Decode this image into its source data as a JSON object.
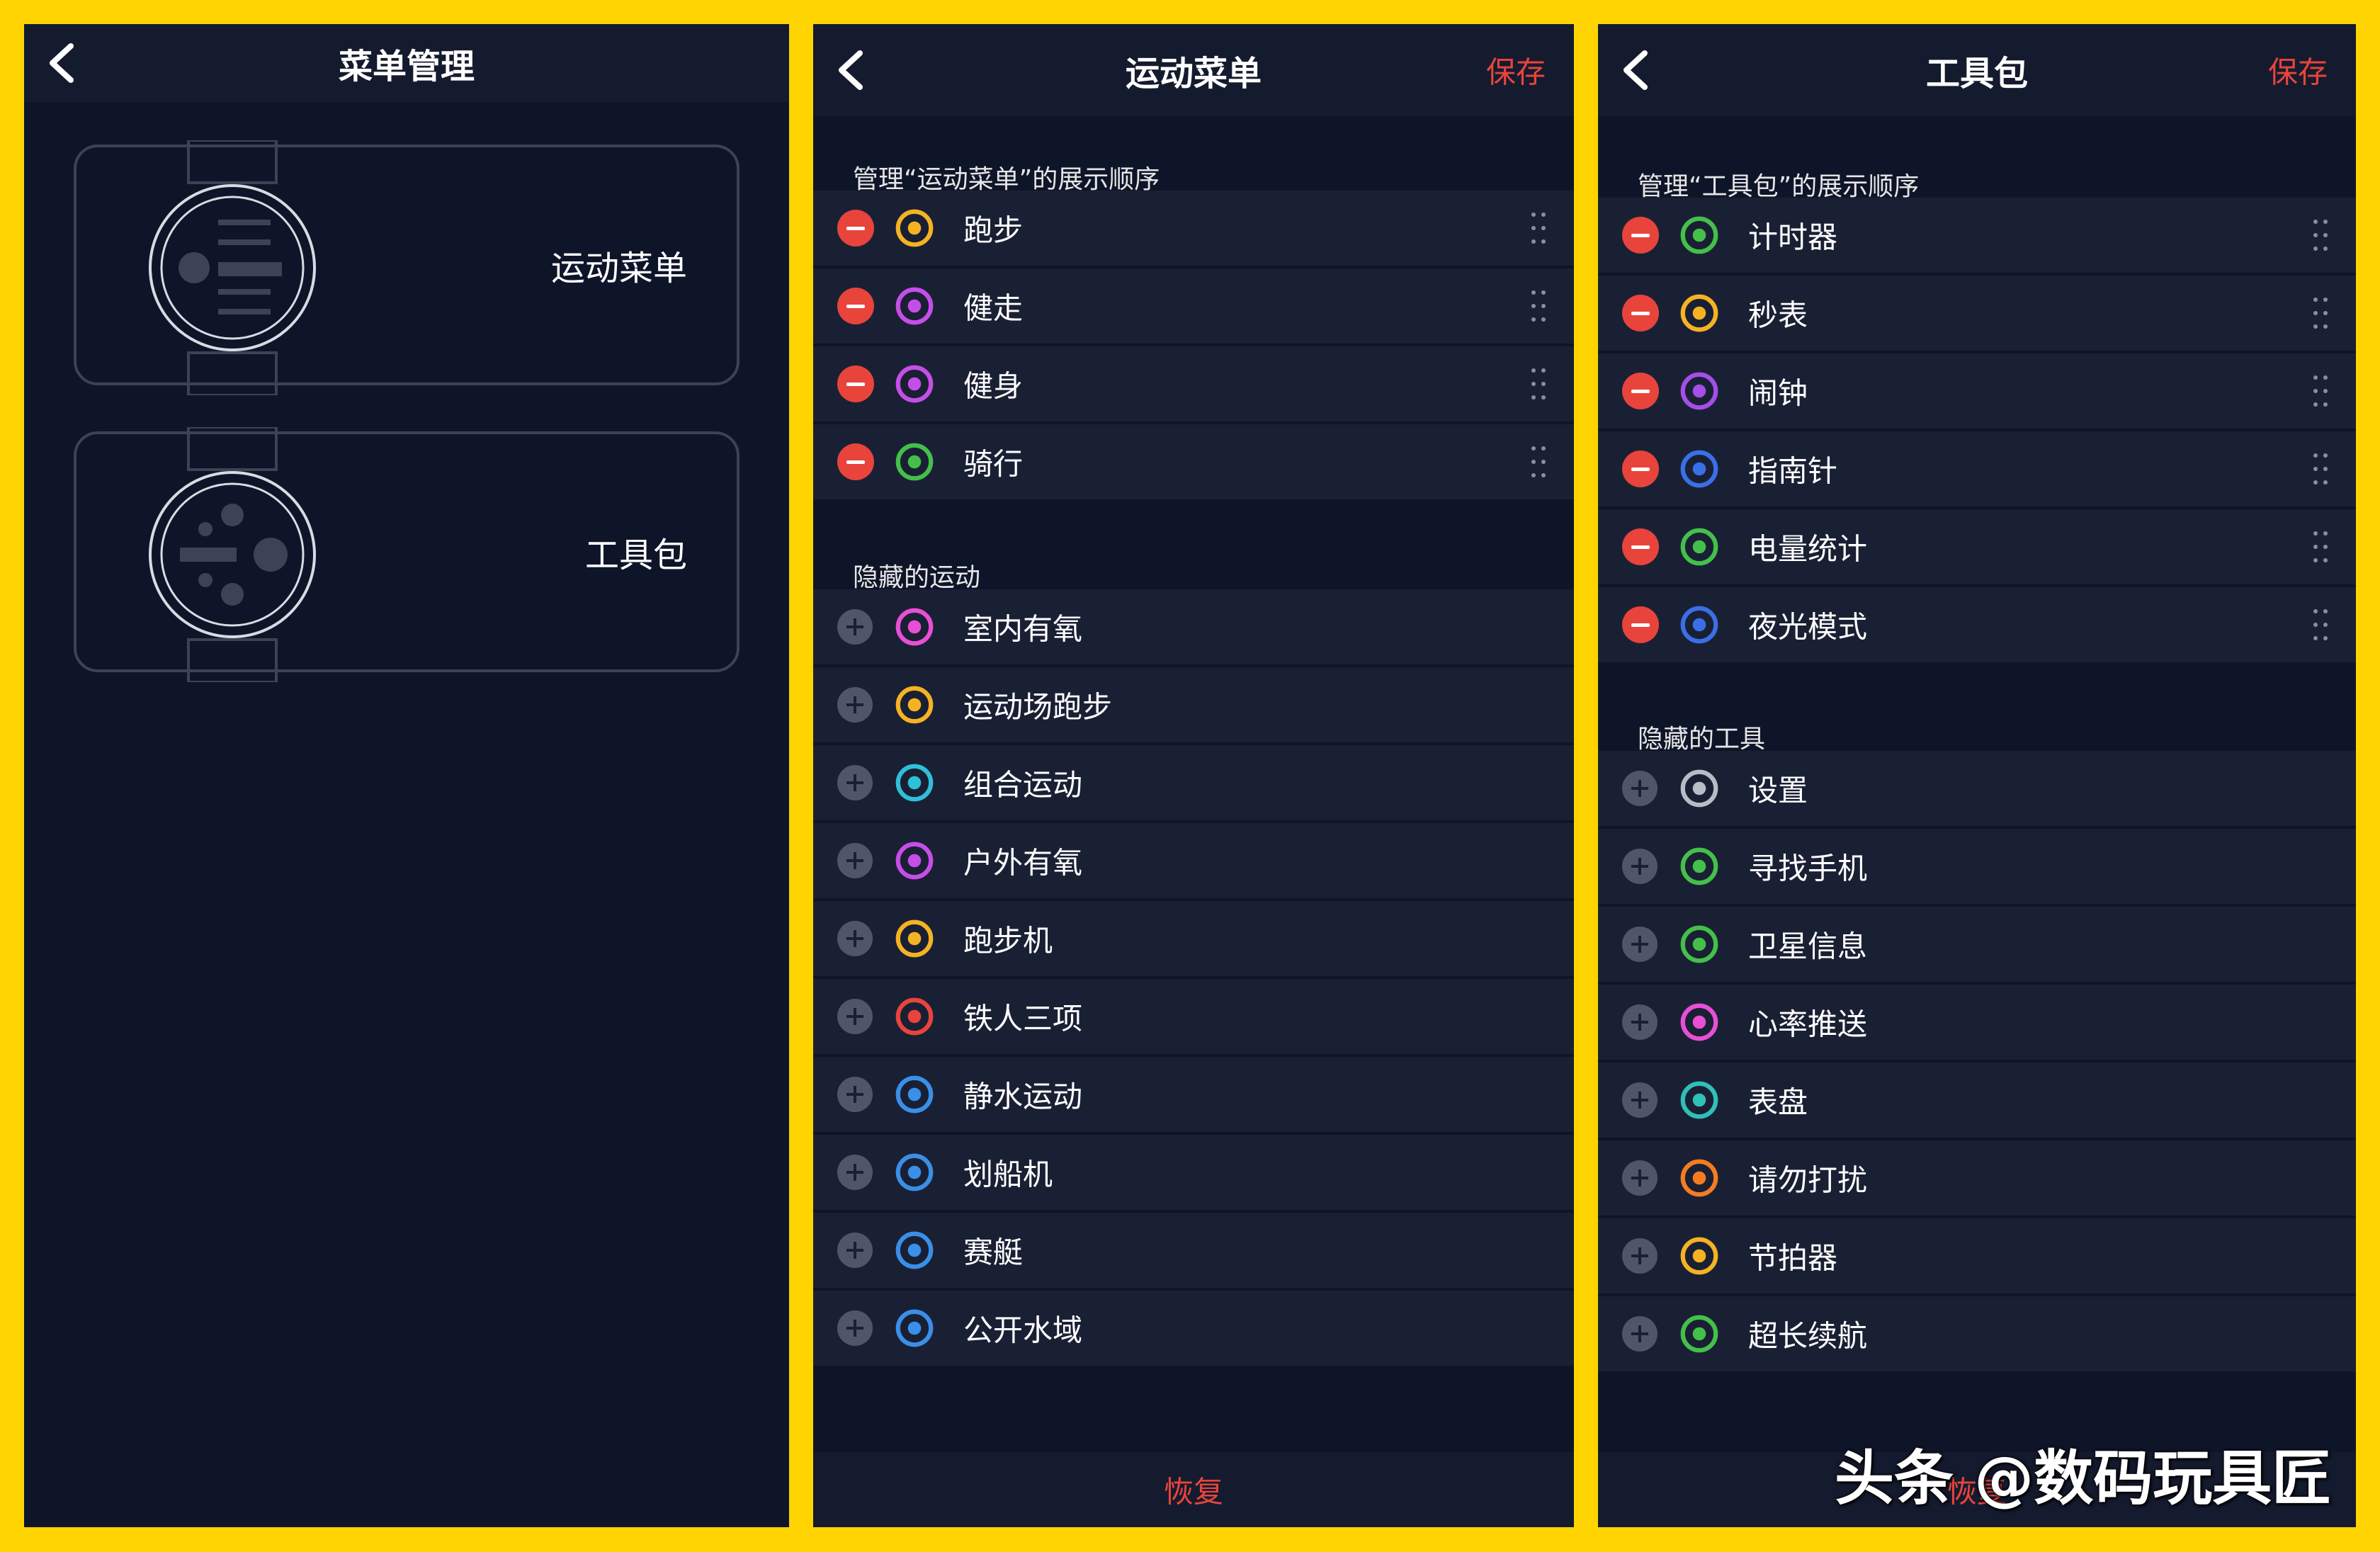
{
  "panel1": {
    "title": "菜单管理",
    "cards": [
      {
        "label": "运动菜单"
      },
      {
        "label": "工具包"
      }
    ]
  },
  "panel2": {
    "title": "运动菜单",
    "save": "保存",
    "section_shown": "管理“运动菜单”的展示顺序",
    "shown": [
      {
        "label": "跑步",
        "icon": "running-icon",
        "color": "#f5b323"
      },
      {
        "label": "健走",
        "icon": "walking-icon",
        "color": "#c64ee8"
      },
      {
        "label": "健身",
        "icon": "fitness-icon",
        "color": "#c64ee8"
      },
      {
        "label": "骑行",
        "icon": "cycling-icon",
        "color": "#44c04a"
      }
    ],
    "section_hidden": "隐藏的运动",
    "hidden": [
      {
        "label": "室内有氧",
        "icon": "indoor-aerobic-icon",
        "color": "#e84fd6"
      },
      {
        "label": "运动场跑步",
        "icon": "track-running-icon",
        "color": "#f5b323"
      },
      {
        "label": "组合运动",
        "icon": "combo-sport-icon",
        "color": "#2fc0d8"
      },
      {
        "label": "户外有氧",
        "icon": "outdoor-aerobic-icon",
        "color": "#c64ee8"
      },
      {
        "label": "跑步机",
        "icon": "treadmill-icon",
        "color": "#f5b323"
      },
      {
        "label": "铁人三项",
        "icon": "triathlon-icon",
        "color": "#e8443c"
      },
      {
        "label": "静水运动",
        "icon": "still-water-icon",
        "color": "#3a8fe8"
      },
      {
        "label": "划船机",
        "icon": "rowing-machine-icon",
        "color": "#3a8fe8"
      },
      {
        "label": "赛艇",
        "icon": "rowing-boat-icon",
        "color": "#3a8fe8"
      },
      {
        "label": "公开水域",
        "icon": "open-water-icon",
        "color": "#3a8fe8"
      }
    ],
    "restore": "恢复"
  },
  "panel3": {
    "title": "工具包",
    "save": "保存",
    "section_shown": "管理“工具包”的展示顺序",
    "shown": [
      {
        "label": "计时器",
        "icon": "timer-icon",
        "color": "#44c04a"
      },
      {
        "label": "秒表",
        "icon": "stopwatch-icon",
        "color": "#f5b323"
      },
      {
        "label": "闹钟",
        "icon": "alarm-icon",
        "color": "#a54ee8"
      },
      {
        "label": "指南针",
        "icon": "compass-icon",
        "color": "#3a6fe8"
      },
      {
        "label": "电量统计",
        "icon": "battery-stats-icon",
        "color": "#44c04a"
      },
      {
        "label": "夜光模式",
        "icon": "night-mode-icon",
        "color": "#3a6fe8"
      }
    ],
    "section_hidden": "隐藏的工具",
    "hidden": [
      {
        "label": "设置",
        "icon": "settings-icon",
        "color": "#b8bcc6"
      },
      {
        "label": "寻找手机",
        "icon": "find-phone-icon",
        "color": "#44c04a"
      },
      {
        "label": "卫星信息",
        "icon": "satellite-icon",
        "color": "#44c04a"
      },
      {
        "label": "心率推送",
        "icon": "heart-rate-push-icon",
        "color": "#e84fd6"
      },
      {
        "label": "表盘",
        "icon": "watch-face-icon",
        "color": "#2fc0b8"
      },
      {
        "label": "请勿打扰",
        "icon": "do-not-disturb-icon",
        "color": "#f57c23"
      },
      {
        "label": "节拍器",
        "icon": "metronome-icon",
        "color": "#f5b323"
      },
      {
        "label": "超长续航",
        "icon": "long-battery-icon",
        "color": "#44c04a"
      }
    ],
    "restore": "恢复"
  },
  "watermark": "头条 @数码玩具匠"
}
